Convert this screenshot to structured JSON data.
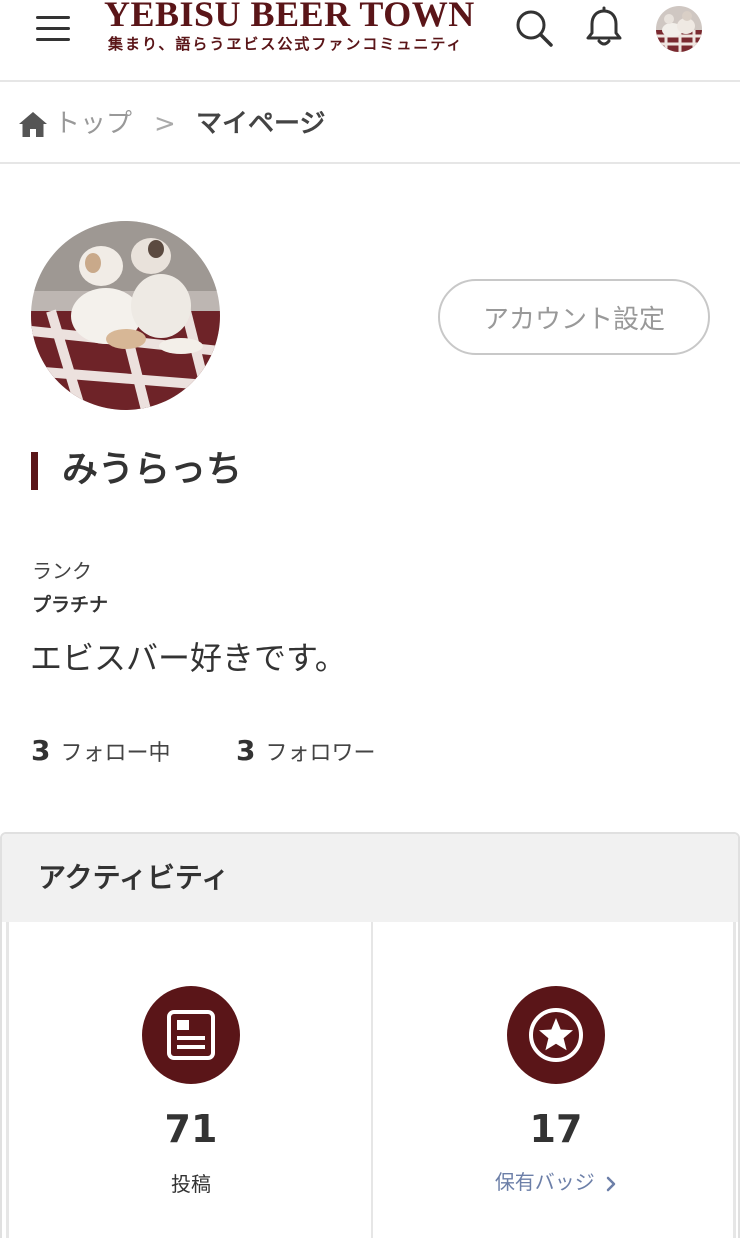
{
  "header": {
    "logo_title": "YEBISU BEER TOWN",
    "logo_subtitle": "集まり、語らうヱビス公式ファンコミュニティ",
    "brand_color": "#5a1518"
  },
  "breadcrumb": {
    "home_label": "トップ",
    "separator": ">",
    "current": "マイページ"
  },
  "profile": {
    "account_button": "アカウント設定",
    "name": "みうらっち",
    "rank_label": "ランク",
    "rank_value": "プラチナ",
    "bio": "エビスバー好きです。",
    "following_count": "3",
    "following_label": "フォロー中",
    "followers_count": "3",
    "followers_label": "フォロワー"
  },
  "activity": {
    "title": "アクティビティ",
    "posts_count": "71",
    "posts_label": "投稿",
    "badges_count": "17",
    "badges_label": "保有バッジ"
  },
  "icons": [
    "menu-icon",
    "search-icon",
    "bell-icon",
    "home-icon",
    "document-icon",
    "star-badge-icon",
    "chevron-right-icon"
  ]
}
